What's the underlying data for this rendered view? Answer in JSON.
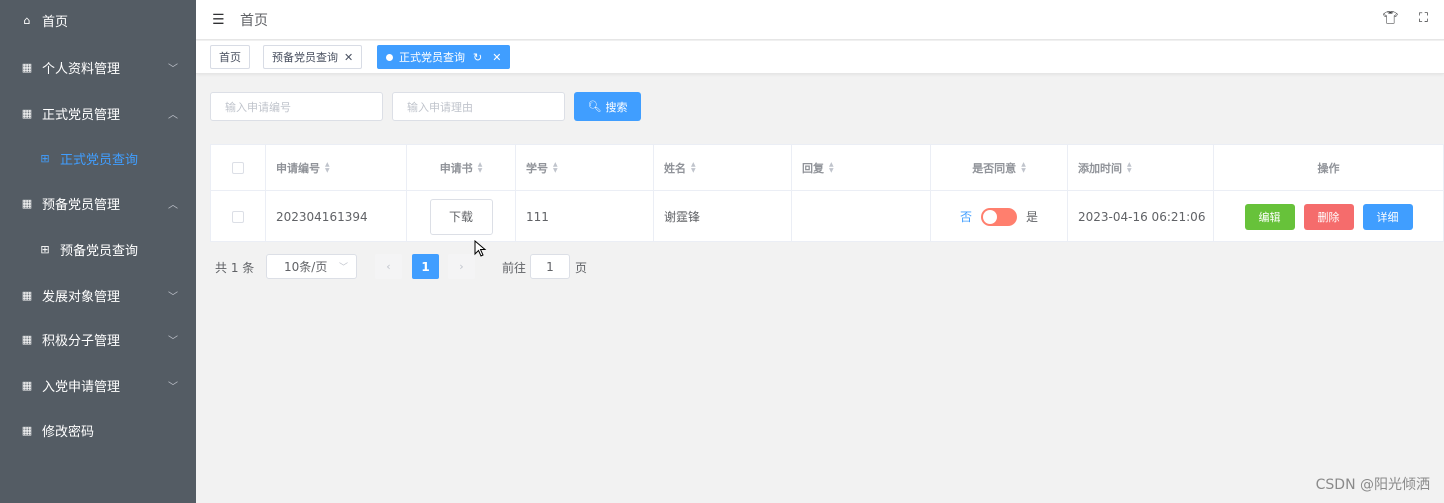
{
  "sidebar": {
    "items": [
      {
        "label": "首页",
        "icon": "home-icon"
      },
      {
        "label": "个人资料管理",
        "icon": "grid-icon",
        "chevron": "down"
      },
      {
        "label": "正式党员管理",
        "icon": "grid-icon",
        "chevron": "up"
      },
      {
        "label": "正式党员查询",
        "icon": "apps-icon",
        "active": true
      },
      {
        "label": "预备党员管理",
        "icon": "grid-icon",
        "chevron": "up"
      },
      {
        "label": "预备党员查询",
        "icon": "apps-icon"
      },
      {
        "label": "发展对象管理",
        "icon": "grid-icon",
        "chevron": "down"
      },
      {
        "label": "积极分子管理",
        "icon": "grid-icon",
        "chevron": "down"
      },
      {
        "label": "入党申请管理",
        "icon": "grid-icon",
        "chevron": "down"
      },
      {
        "label": "修改密码",
        "icon": "grid-icon"
      }
    ]
  },
  "header": {
    "breadcrumb": "首页",
    "icons": [
      "theme-icon",
      "fullscreen-icon"
    ]
  },
  "tags": [
    {
      "label": "首页"
    },
    {
      "label": "预备党员查询",
      "closable": true
    },
    {
      "label": "正式党员查询",
      "closable": true,
      "active": true
    }
  ],
  "search": {
    "id_placeholder": "输入申请编号",
    "reason_placeholder": "输入申请理由",
    "button_label": "搜索"
  },
  "table": {
    "columns": [
      "申请编号",
      "申请书",
      "学号",
      "姓名",
      "回复",
      "是否同意",
      "添加时间",
      "操作"
    ],
    "rows": [
      {
        "id": "202304161394",
        "doc_button": "下载",
        "student_no": "111",
        "name": "谢霆锋",
        "reply": "",
        "agree_off": "否",
        "agree_on": "是",
        "agree_value": false,
        "time": "2023-04-16 06:21:06",
        "actions": [
          "编辑",
          "删除",
          "详细"
        ]
      }
    ]
  },
  "pagination": {
    "total": "共 1 条",
    "page_size": "10条/页",
    "current": "1",
    "goto_prefix": "前往",
    "goto_value": "1",
    "goto_suffix": "页"
  },
  "watermark": "CSDN @阳光倾洒",
  "colors": {
    "sidebar_bg": "#545c64",
    "primary": "#409eff",
    "success": "#67c23a",
    "danger": "#f56c6c",
    "switch_off": "#ff7f6e"
  }
}
